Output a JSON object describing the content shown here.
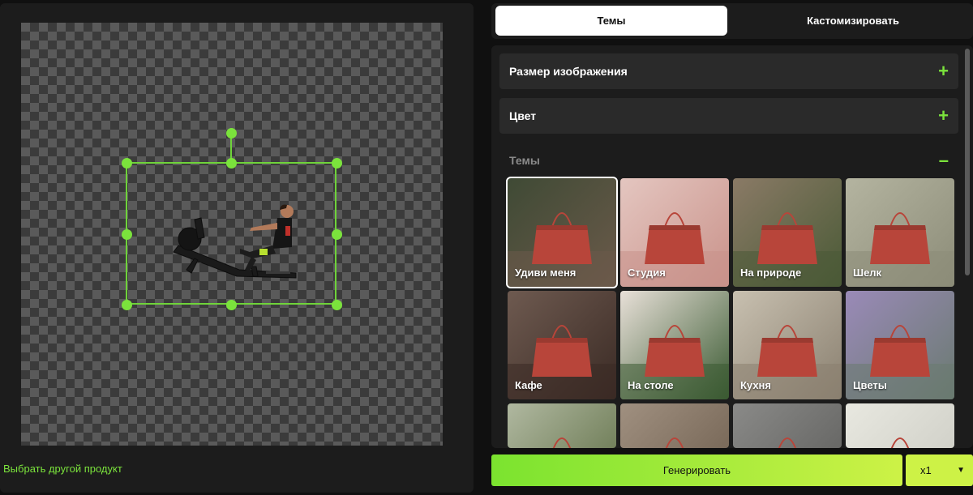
{
  "editor": {
    "switch_product_label": "Выбрать другой продукт",
    "product_icon": "rowing-machine-person"
  },
  "tabs": [
    {
      "label": "Темы",
      "active": true
    },
    {
      "label": "Кастомизировать",
      "active": false
    }
  ],
  "options": {
    "image_size": {
      "title": "Размер изображения",
      "sign": "+"
    },
    "color": {
      "title": "Цвет",
      "sign": "+"
    },
    "themes": {
      "title": "Темы",
      "sign": "–"
    }
  },
  "themes": [
    {
      "label": "Удиви меня",
      "selected": true,
      "bg": "#6b5a4a",
      "bg2": "#3f4a35"
    },
    {
      "label": "Студия",
      "selected": false,
      "bg": "#c9928a",
      "bg2": "#e4c6c0"
    },
    {
      "label": "На природе",
      "selected": false,
      "bg": "#4a5a36",
      "bg2": "#8a7a66"
    },
    {
      "label": "Шелк",
      "selected": false,
      "bg": "#8c8c78",
      "bg2": "#b4b4a0"
    },
    {
      "label": "Кафе",
      "selected": false,
      "bg": "#3a2a24",
      "bg2": "#6e5a50"
    },
    {
      "label": "На столе",
      "selected": false,
      "bg": "#3a5a32",
      "bg2": "#e8e0d8"
    },
    {
      "label": "Кухня",
      "selected": false,
      "bg": "#8a8070",
      "bg2": "#c8c0b0"
    },
    {
      "label": "Цветы",
      "selected": false,
      "bg": "#6a7a70",
      "bg2": "#9a8ab8"
    },
    {
      "label": "",
      "selected": false,
      "bg": "#5a6a40",
      "bg2": "#b0b8a0"
    },
    {
      "label": "",
      "selected": false,
      "bg": "#6a5a4a",
      "bg2": "#a09080"
    },
    {
      "label": "",
      "selected": false,
      "bg": "#5a5a58",
      "bg2": "#8a8a88"
    },
    {
      "label": "",
      "selected": false,
      "bg": "#c8c8c0",
      "bg2": "#e8e8e0"
    }
  ],
  "actions": {
    "generate_label": "Генерировать",
    "count_value": "x1",
    "count_arrow": "▼"
  },
  "colors": {
    "accent": "#7be33c",
    "bag": "#b8453a"
  }
}
